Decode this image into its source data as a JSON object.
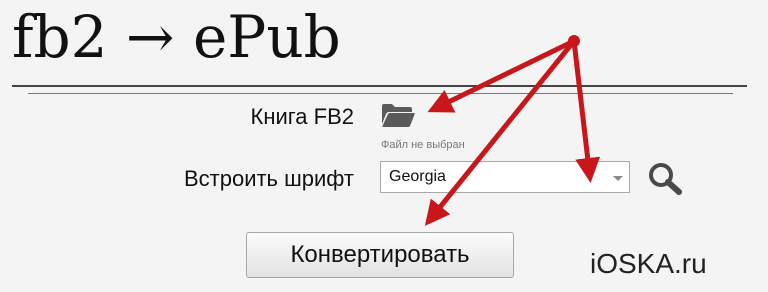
{
  "header": {
    "title": "fb2 → ePub"
  },
  "form": {
    "book_label": "Книга FB2",
    "file_status": "Файл не выбран",
    "font_label": "Встроить шрифт",
    "font_select": {
      "selected": "Georgia"
    },
    "convert_label": "Конвертировать"
  },
  "watermark": "iOSKA.ru",
  "icons": {
    "folder": "folder-icon",
    "search": "search-icon",
    "dropdown": "chevron-down-icon"
  },
  "colors": {
    "annotation_arrow": "#c8161a",
    "icon": "#5a5a5a",
    "background": "#f4f4f4"
  }
}
